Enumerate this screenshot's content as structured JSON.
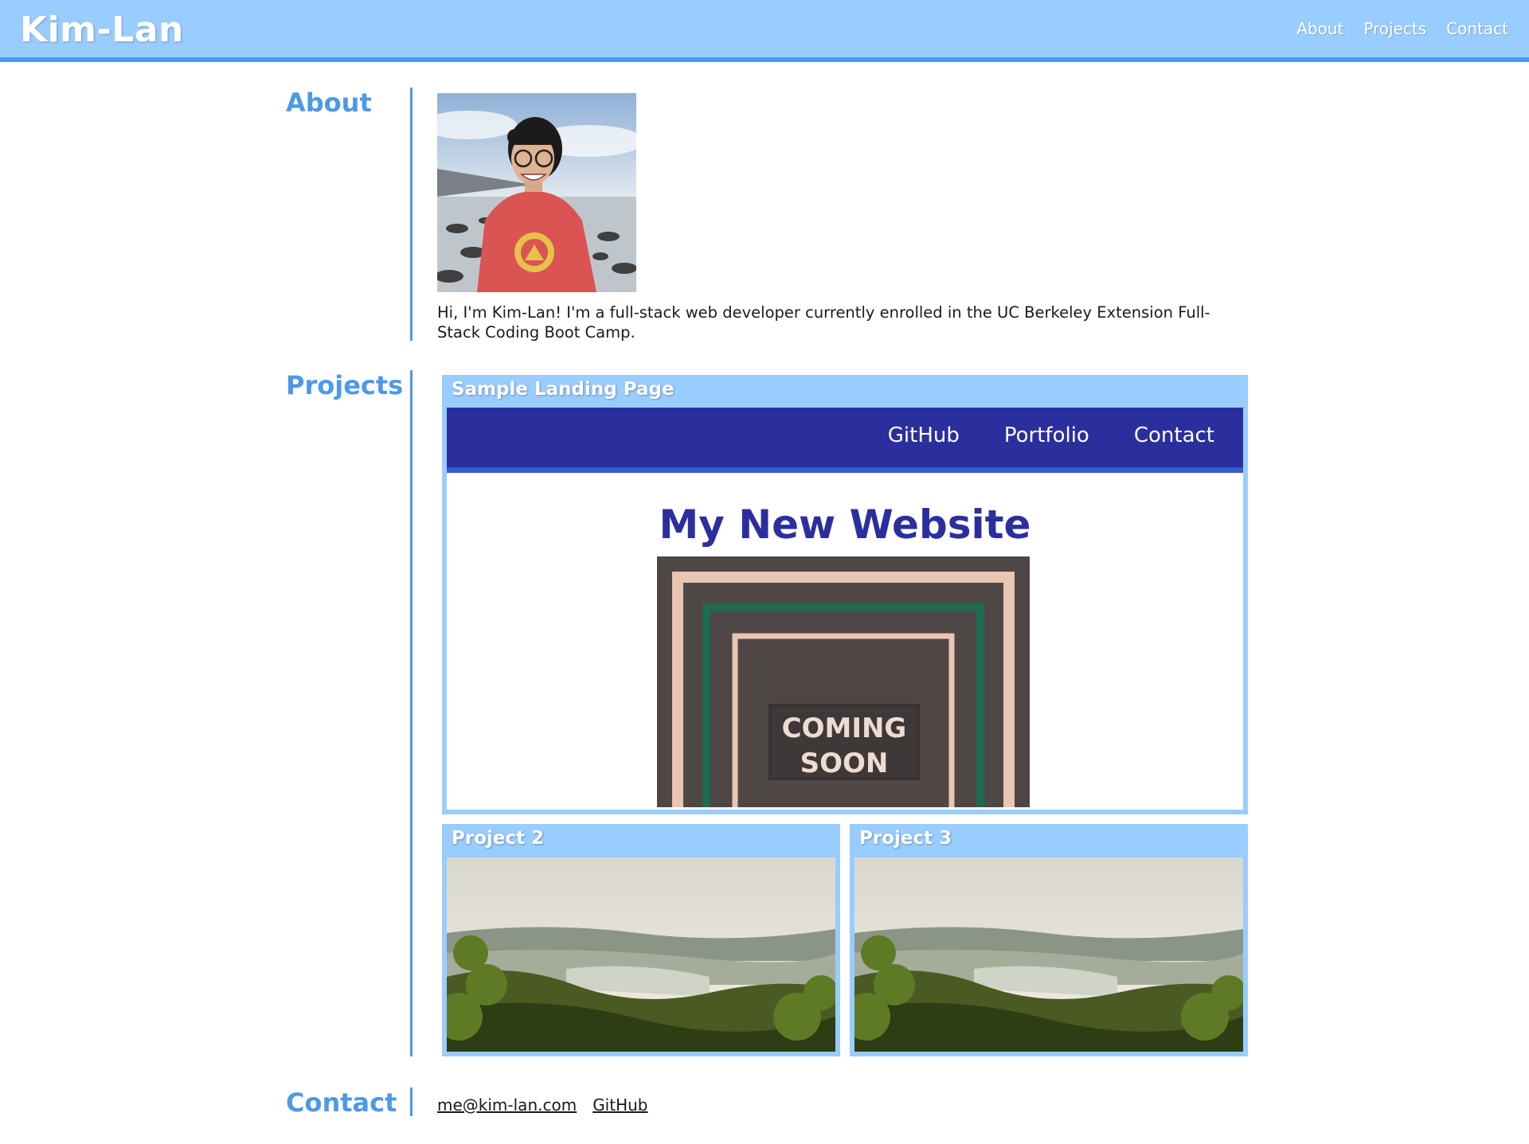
{
  "header": {
    "brand": "Kim-Lan",
    "nav": [
      "About",
      "Projects",
      "Contact"
    ]
  },
  "about": {
    "title": "About",
    "bio": "Hi, I'm Kim-Lan! I'm a full-stack web developer currently enrolled in the UC Berkeley Extension Full-Stack Coding Boot Camp."
  },
  "projects": {
    "title": "Projects",
    "featured": {
      "title": "Sample Landing Page",
      "mock_nav": [
        "GitHub",
        "Portfolio",
        "Contact"
      ],
      "mock_heading": "My New Website",
      "coming_soon": [
        "COMING",
        "SOON"
      ]
    },
    "cards": [
      {
        "title": "Project 2"
      },
      {
        "title": "Project 3"
      }
    ]
  },
  "contact": {
    "title": "Contact",
    "links": [
      "me@kim-lan.com",
      "GitHub"
    ]
  },
  "colors": {
    "header_bg": "#99ccff",
    "accent": "#4d99e6",
    "mock_nav": "#2b2f9e"
  }
}
